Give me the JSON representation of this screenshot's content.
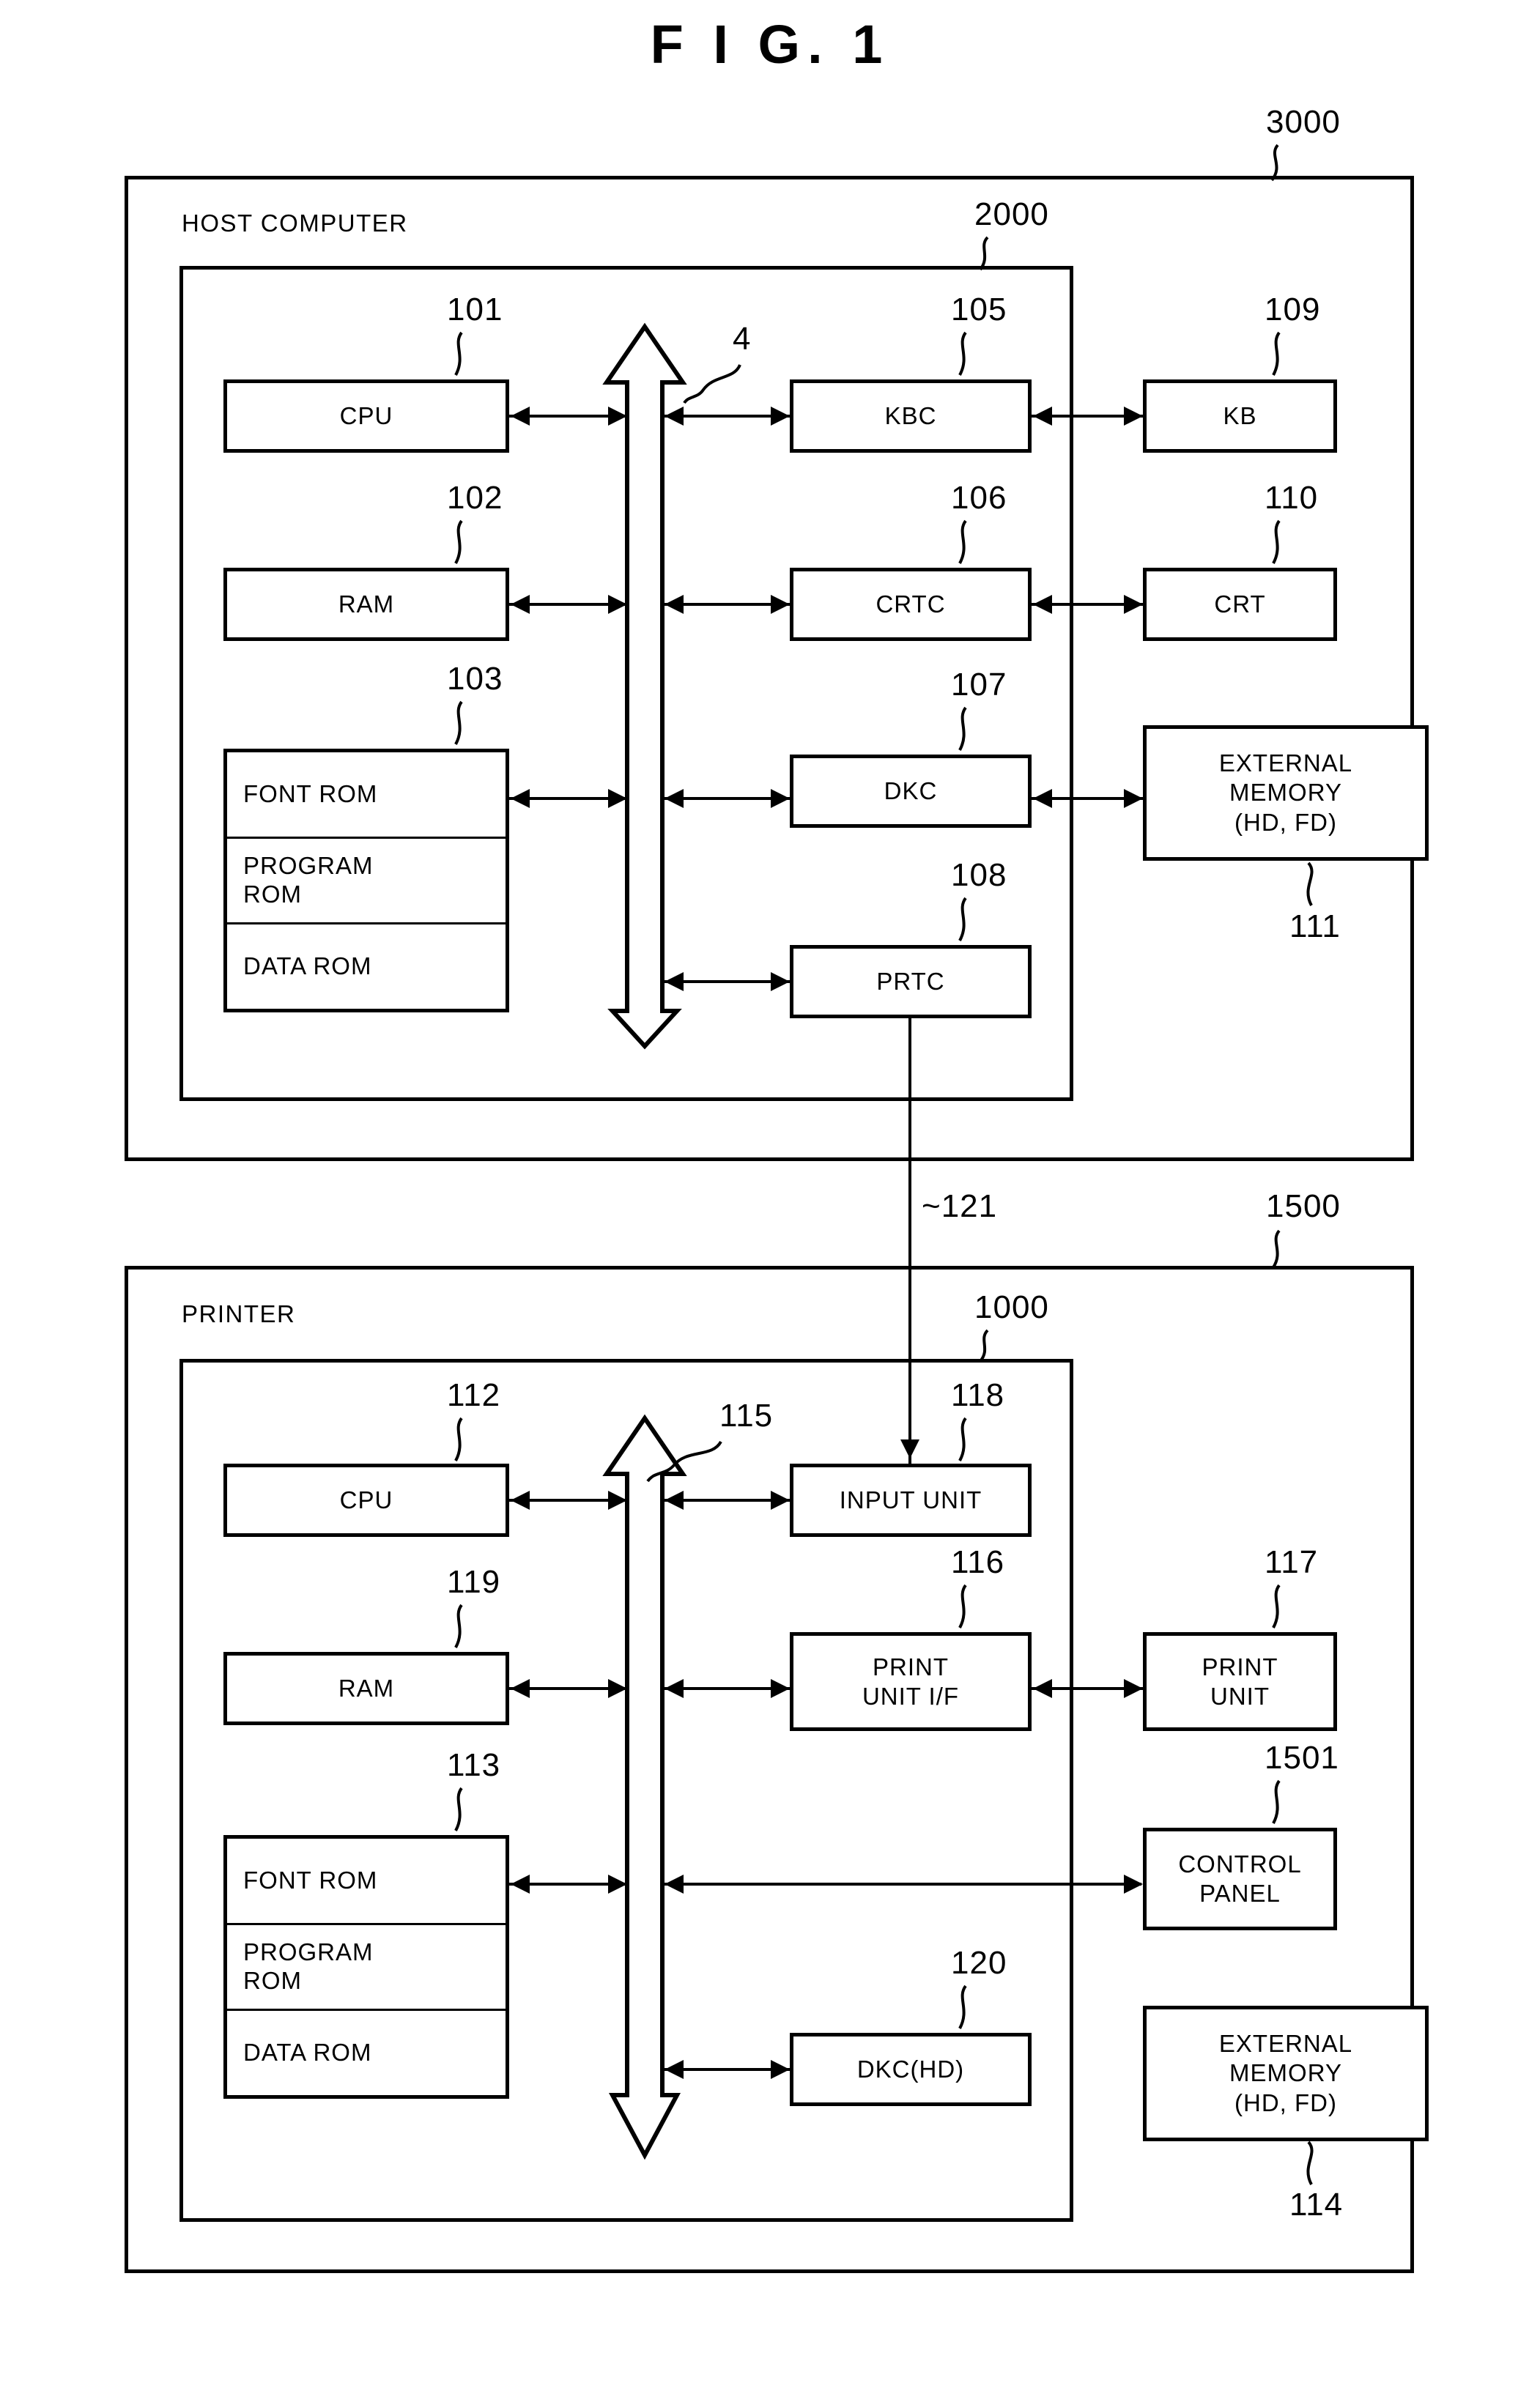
{
  "figure": {
    "title": "F I G.  1"
  },
  "host": {
    "outer_ref": "3000",
    "inner_ref": "2000",
    "section_label": "HOST COMPUTER",
    "bus_ref": "4",
    "boxes": [
      {
        "ref": "101",
        "label": "CPU"
      },
      {
        "ref": "102",
        "label": "RAM"
      },
      {
        "ref": "105",
        "label": "KBC"
      },
      {
        "ref": "106",
        "label": "CRTC"
      },
      {
        "ref": "107",
        "label": "DKC"
      },
      {
        "ref": "108",
        "label": "PRTC"
      },
      {
        "ref": "109",
        "label": "KB"
      },
      {
        "ref": "110",
        "label": "CRT"
      },
      {
        "ref": "111",
        "label": "EXTERNAL\nMEMORY\n(HD, FD)"
      }
    ],
    "rom": {
      "ref": "103",
      "cells": [
        "FONT ROM",
        "PROGRAM\nROM",
        "DATA ROM"
      ]
    },
    "external_memory": {
      "line1": "EXTERNAL",
      "line2": "MEMORY",
      "line3": "(HD, FD)"
    }
  },
  "link": {
    "ref": "121",
    "tilde": "~"
  },
  "printer": {
    "outer_ref": "1500",
    "inner_ref": "1000",
    "section_label": "PRINTER",
    "bus_ref": "115",
    "boxes": [
      {
        "ref": "112",
        "label": "CPU"
      },
      {
        "ref": "119",
        "label": "RAM"
      },
      {
        "ref": "118",
        "label": "INPUT UNIT"
      },
      {
        "ref": "116",
        "label": "PRINT\nUNIT I/F"
      },
      {
        "ref": "117",
        "label": "PRINT\nUNIT"
      },
      {
        "ref": "120",
        "label": "DKC(HD)"
      },
      {
        "ref": "1501",
        "label": "CONTROL\nPANEL"
      },
      {
        "ref": "114",
        "label": "EXTERNAL\nMEMORY\n(HD, FD)"
      }
    ],
    "rom": {
      "ref": "113",
      "cells": [
        "FONT ROM",
        "PROGRAM\nROM",
        "DATA ROM"
      ]
    },
    "print_unit_if": {
      "line1": "PRINT",
      "line2": "UNIT I/F"
    },
    "print_unit": {
      "line1": "PRINT",
      "line2": "UNIT"
    },
    "control_panel": {
      "line1": "CONTROL",
      "line2": "PANEL"
    },
    "external_memory": {
      "line1": "EXTERNAL",
      "line2": "MEMORY",
      "line3": "(HD, FD)"
    }
  },
  "labels": {
    "cpu": "CPU",
    "ram": "RAM",
    "kbc": "KBC",
    "crtc": "CRTC",
    "dkc": "DKC",
    "prtc": "PRTC",
    "kb": "KB",
    "crt": "CRT",
    "input_unit": "INPUT UNIT",
    "dkc_hd": "DKC(HD)",
    "font_rom": "FONT ROM",
    "program_rom_l1": "PROGRAM",
    "program_rom_l2": "ROM",
    "data_rom": "DATA ROM"
  },
  "refs": {
    "r3000": "3000",
    "r2000": "2000",
    "r4": "4",
    "r101": "101",
    "r102": "102",
    "r103": "103",
    "r105": "105",
    "r106": "106",
    "r107": "107",
    "r108": "108",
    "r109": "109",
    "r110": "110",
    "r111": "111",
    "r121": "~121",
    "r1500": "1500",
    "r1000": "1000",
    "r115": "115",
    "r112": "112",
    "r119": "119",
    "r113": "113",
    "r116": "116",
    "r117": "117",
    "r118": "118",
    "r120": "120",
    "r1501": "1501",
    "r114": "114"
  },
  "colors": {
    "ink": "#000000",
    "paper": "#ffffff"
  }
}
